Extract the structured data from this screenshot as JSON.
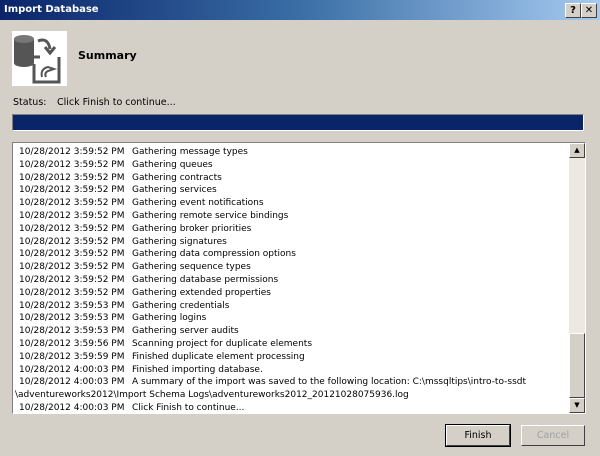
{
  "window": {
    "title": "Import Database",
    "help": "?",
    "close": "✕"
  },
  "header": {
    "title": "Summary",
    "icon": "database-import-icon"
  },
  "status": {
    "label": "Status:",
    "value": "Click Finish to continue...",
    "progress": 100
  },
  "log": [
    {
      "time": "10/28/2012 3:59:52 PM",
      "msg": "Gathering message types"
    },
    {
      "time": "10/28/2012 3:59:52 PM",
      "msg": "Gathering queues"
    },
    {
      "time": "10/28/2012 3:59:52 PM",
      "msg": "Gathering contracts"
    },
    {
      "time": "10/28/2012 3:59:52 PM",
      "msg": "Gathering services"
    },
    {
      "time": "10/28/2012 3:59:52 PM",
      "msg": "Gathering event notifications"
    },
    {
      "time": "10/28/2012 3:59:52 PM",
      "msg": "Gathering remote service bindings"
    },
    {
      "time": "10/28/2012 3:59:52 PM",
      "msg": "Gathering broker priorities"
    },
    {
      "time": "10/28/2012 3:59:52 PM",
      "msg": "Gathering signatures"
    },
    {
      "time": "10/28/2012 3:59:52 PM",
      "msg": "Gathering data compression options"
    },
    {
      "time": "10/28/2012 3:59:52 PM",
      "msg": "Gathering sequence types"
    },
    {
      "time": "10/28/2012 3:59:52 PM",
      "msg": "Gathering database permissions"
    },
    {
      "time": "10/28/2012 3:59:52 PM",
      "msg": "Gathering extended properties"
    },
    {
      "time": "10/28/2012 3:59:53 PM",
      "msg": "Gathering credentials"
    },
    {
      "time": "10/28/2012 3:59:53 PM",
      "msg": "Gathering logins"
    },
    {
      "time": "10/28/2012 3:59:53 PM",
      "msg": "Gathering server audits"
    },
    {
      "time": "10/28/2012 3:59:56 PM",
      "msg": "Scanning project for duplicate elements"
    },
    {
      "time": "10/28/2012 3:59:59 PM",
      "msg": "Finished duplicate element processing"
    },
    {
      "time": "10/28/2012 4:00:03 PM",
      "msg": "Finished importing database."
    },
    {
      "time": "10/28/2012 4:00:03 PM",
      "msg": "A summary of the import was saved to the following location: C:\\mssqltips\\intro-to-ssdt"
    },
    {
      "time": "",
      "msg": "\\adventureworks2012\\Import Schema Logs\\adventureworks2012_20121028075936.log",
      "wrap": true
    },
    {
      "time": "10/28/2012 4:00:03 PM",
      "msg": "Click Finish to continue..."
    }
  ],
  "buttons": {
    "finish": "Finish",
    "cancel": "Cancel"
  }
}
